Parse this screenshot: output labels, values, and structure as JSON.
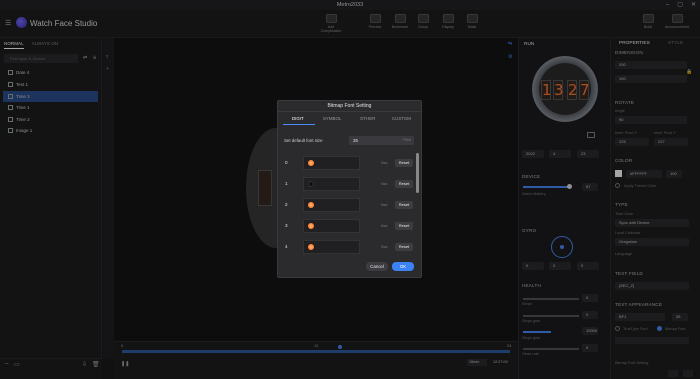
{
  "window": {
    "title": "Metro2033",
    "controls": [
      "–",
      "▢",
      "✕"
    ]
  },
  "app": {
    "name": "Watch Face Studio"
  },
  "toolbar": {
    "items": [
      {
        "label": "Add Complication"
      },
      {
        "label": "Preview"
      },
      {
        "label": "Bookmark"
      },
      {
        "label": "Group"
      },
      {
        "label": "Display"
      },
      {
        "label": "Mask"
      },
      {
        "label": "Build"
      },
      {
        "label": "Announcement"
      }
    ]
  },
  "left": {
    "tabs": [
      "NORMAL",
      "ALWAYS ON"
    ],
    "search_placeholder": "Find layer & Search",
    "layers": [
      {
        "label": "Date 4",
        "selected": false
      },
      {
        "label": "Text 1",
        "selected": false
      },
      {
        "label": "Time 3",
        "selected": true
      },
      {
        "label": "Time 1",
        "selected": false
      },
      {
        "label": "Time 2",
        "selected": false
      },
      {
        "label": "Image 1",
        "selected": false
      }
    ]
  },
  "timeline": {
    "start": "0",
    "mid": "12",
    "end": "24",
    "zoom": "15min",
    "time": "12:27:00"
  },
  "run": {
    "tab": "RUN",
    "digits": [
      "1",
      "3",
      "2",
      "7"
    ],
    "date": {
      "year": "2022",
      "month": "4",
      "day": "23"
    },
    "device_label": "DEVICE",
    "battery_label": "Watch Battery",
    "battery_value": "87",
    "gyro_label": "GYRO",
    "gyro": [
      "0",
      "0",
      "0"
    ],
    "health_label": "HEALTH",
    "health": [
      {
        "label": "Steps",
        "value": "0"
      },
      {
        "label": "Steps goal",
        "value": "0"
      },
      {
        "label": "Steps goal",
        "value": "10000"
      },
      {
        "label": "Heart rate",
        "value": "0"
      }
    ]
  },
  "props": {
    "tabs": [
      "PROPERTIES",
      "STYLE"
    ],
    "dimension_label": "DIMENSION",
    "dim": [
      "200",
      "100"
    ],
    "rotate_label": "ROTATE",
    "angle_label": "Angle",
    "angle": "90",
    "inner_label_x": "Inner Pivot X",
    "inner_label_y": "Inner Pivot Y",
    "inner_x": "225",
    "inner_y": "227",
    "color_label": "COLOR",
    "color_hex": "#FFFFFF",
    "opacity": "100",
    "theme_label": "Apply Theme Color",
    "type_label": "TYPE",
    "time_zone_label": "Time Zone",
    "time_zone": "Sync with Device",
    "local_cal_label": "Local Calendar",
    "local_cal": "Gregorian",
    "language_label": "Language",
    "textfield_label": "TEXT FIELD",
    "textfield_value": "[SEC_Z]",
    "textapp_label": "TEXT APPEARANCE",
    "font": "BF1",
    "font_size": "35",
    "opt_truetype": "TrueType Font",
    "opt_bitmap": "Bitmap Font",
    "bitmap_setting": "Bitmap Font Setting"
  },
  "modal": {
    "title": "Bitmap Font Setting",
    "tabs": [
      "DIGIT",
      "SYMBOL",
      "OTHER",
      "CUSTOM"
    ],
    "default_size_label": "Set default font size",
    "default_size": "35",
    "unit": "Pixel",
    "digits": [
      {
        "num": "0",
        "max": "Max",
        "reset": "Reset"
      },
      {
        "num": "1",
        "max": "Max",
        "reset": "Reset"
      },
      {
        "num": "2",
        "max": "Max",
        "reset": "Reset"
      },
      {
        "num": "3",
        "max": "Max",
        "reset": "Reset"
      },
      {
        "num": "4",
        "max": "Max",
        "reset": "Reset"
      }
    ],
    "cancel": "Cancel",
    "ok": "OK"
  },
  "colors": {
    "accent": "#3b82f6",
    "selected_layer": "#2c4f8f",
    "nixie": "#ff7a3a"
  }
}
